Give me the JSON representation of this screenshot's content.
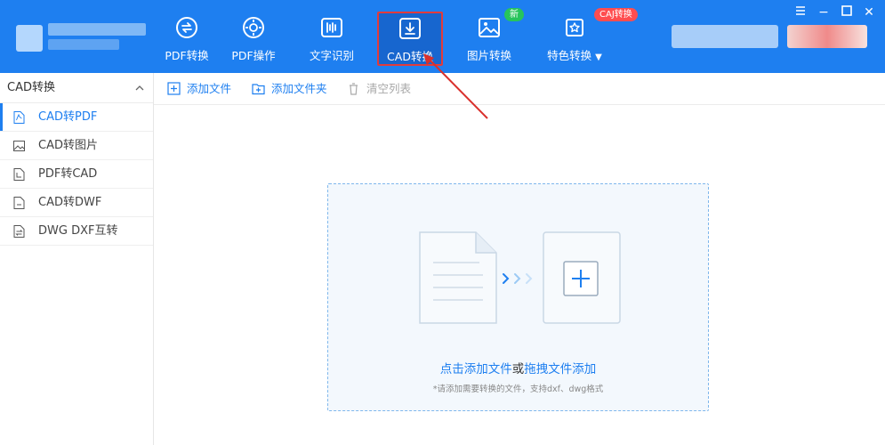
{
  "nav": {
    "items": [
      {
        "label": "PDF转换",
        "icon": "pdf-convert-icon"
      },
      {
        "label": "PDF操作",
        "icon": "pdf-operate-icon"
      },
      {
        "label": "文字识别",
        "icon": "ocr-icon"
      },
      {
        "label": "CAD转换",
        "icon": "cad-convert-icon"
      },
      {
        "label": "图片转换",
        "icon": "image-convert-icon"
      },
      {
        "label": "特色转换",
        "icon": "special-convert-icon"
      }
    ],
    "badge_new": "新",
    "badge_caj": "CAJ转换",
    "special_dropdown": "▼"
  },
  "window": {
    "minimize": "−",
    "close": "✕"
  },
  "sidebar": {
    "header": "CAD转换",
    "items": [
      {
        "label": "CAD转PDF"
      },
      {
        "label": "CAD转图片"
      },
      {
        "label": "PDF转CAD"
      },
      {
        "label": "CAD转DWF"
      },
      {
        "label": "DWG DXF互转"
      }
    ]
  },
  "toolbar": {
    "add_file": "添加文件",
    "add_folder": "添加文件夹",
    "clear_list": "清空列表"
  },
  "dropzone": {
    "click_add": "点击添加文件",
    "or": "或",
    "drag_add": "拖拽文件添加",
    "hint": "*请添加需要转换的文件，支持dxf、dwg格式"
  },
  "colors": {
    "brand": "#1e7ff0",
    "highlight": "#e23b3b",
    "badge_new": "#27c45b",
    "badge_caj": "#ff4d4f"
  }
}
